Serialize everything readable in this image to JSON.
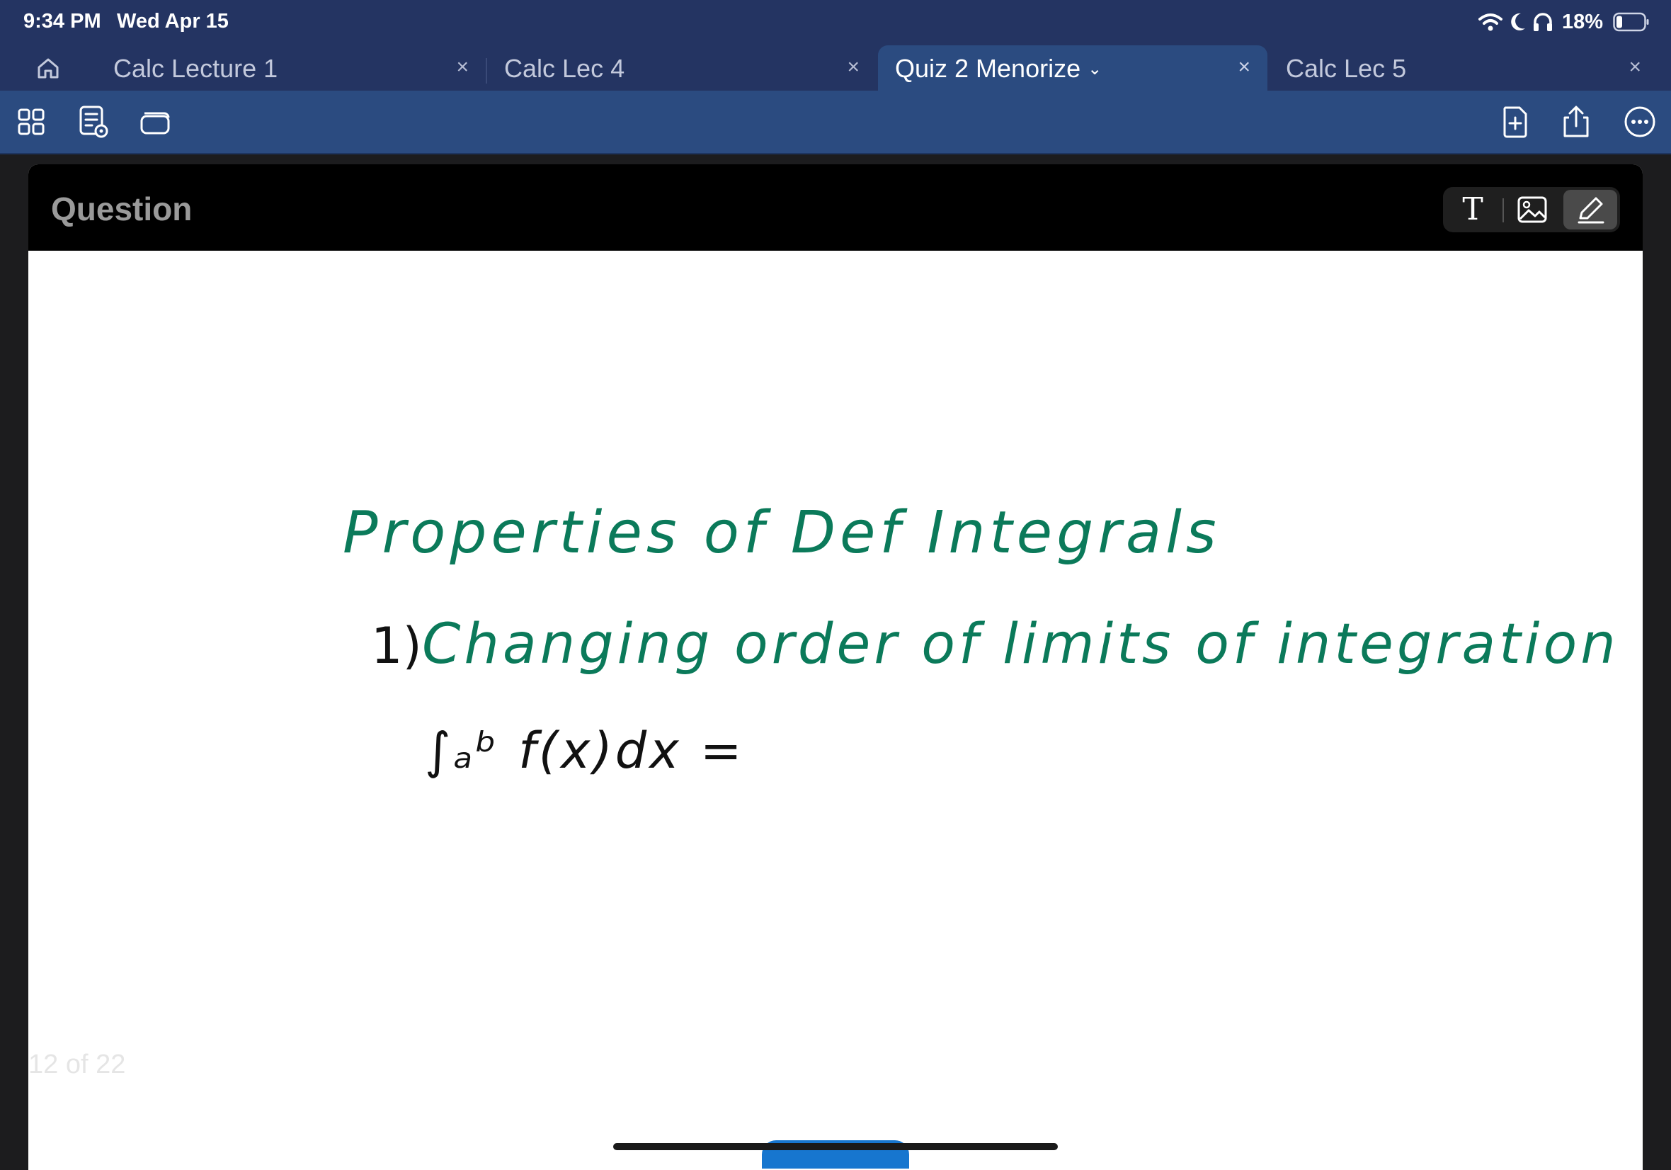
{
  "status_bar": {
    "time": "9:34 PM",
    "date": "Wed Apr 15",
    "battery": "18%",
    "icons": [
      "wifi-icon",
      "moon-icon",
      "headphones-icon",
      "battery-icon"
    ]
  },
  "tabs": [
    {
      "label": "Calc Lecture 1",
      "active": false
    },
    {
      "label": "Calc Lec 4",
      "active": false
    },
    {
      "label": "Quiz 2 Menorize",
      "active": true
    },
    {
      "label": "Calc Lec 5",
      "active": false
    }
  ],
  "tab_close_glyph": "×",
  "toolbar": {
    "left_icons": [
      "grid-icon",
      "note-view-icon",
      "rounded-rect-icon"
    ],
    "right_icons": [
      "add-page-icon",
      "share-icon",
      "more-icon"
    ]
  },
  "card": {
    "title": "Question",
    "tools": [
      "text-tool-icon",
      "image-tool-icon",
      "pen-tool-icon"
    ],
    "text_tool_glyph": "T",
    "page_counter": "12 of 22"
  },
  "handwriting": {
    "heading": "Properties of Def Integrals",
    "item_number": "1)",
    "item_text": "Changing order of limits of integration",
    "formula": "∫ₐᵇ f(x)dx ="
  },
  "colors": {
    "status_bar": "#243462",
    "toolbar": "#2b4b80",
    "ink_green": "#0b7a5a",
    "ink_black": "#111111",
    "accent_blue": "#1776cf"
  }
}
